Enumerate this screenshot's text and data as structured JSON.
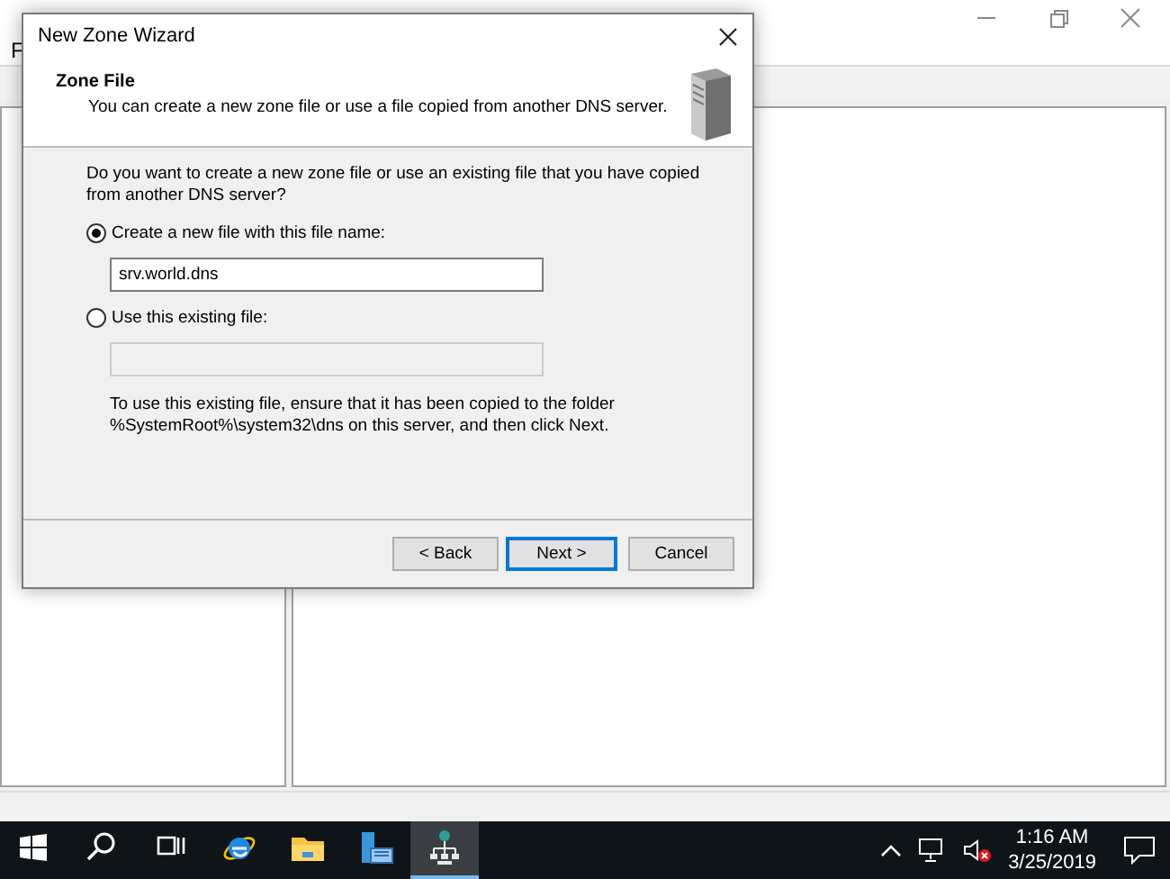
{
  "background_window": {
    "menu": [
      "F"
    ]
  },
  "dialog": {
    "title": "New Zone Wizard",
    "header": {
      "title": "Zone File",
      "subtitle": "You can create a new zone file or use a file copied from another DNS server."
    },
    "question": "Do you want to create a new zone file or use an existing file that you have copied\nfrom another DNS server?",
    "options": [
      {
        "label": "Create a new file with this file name:",
        "selected": true,
        "value": "srv.world.dns",
        "disabled": false
      },
      {
        "label": "Use this existing file:",
        "selected": false,
        "disabled": true
      }
    ],
    "note": "To use this existing file, ensure that it has been copied to the folder\n%SystemRoot%\\system32\\dns on this server, and then click Next.",
    "buttons": [
      {
        "label": "< Back",
        "default": false
      },
      {
        "label": "Next >",
        "default": true
      },
      {
        "label": "Cancel",
        "default": false
      }
    ]
  },
  "taskbar": {
    "apps": [
      {
        "kind": "start",
        "selected": false
      },
      {
        "kind": "search",
        "selected": false
      },
      {
        "kind": "taskview",
        "selected": false
      },
      {
        "kind": "browser",
        "selected": false
      },
      {
        "kind": "folder",
        "selected": false
      },
      {
        "kind": "servermanager",
        "selected": false
      },
      {
        "kind": "dns",
        "selected": true
      }
    ],
    "clock": {
      "time": "1:16 AM",
      "date": "3/25/2019"
    }
  }
}
